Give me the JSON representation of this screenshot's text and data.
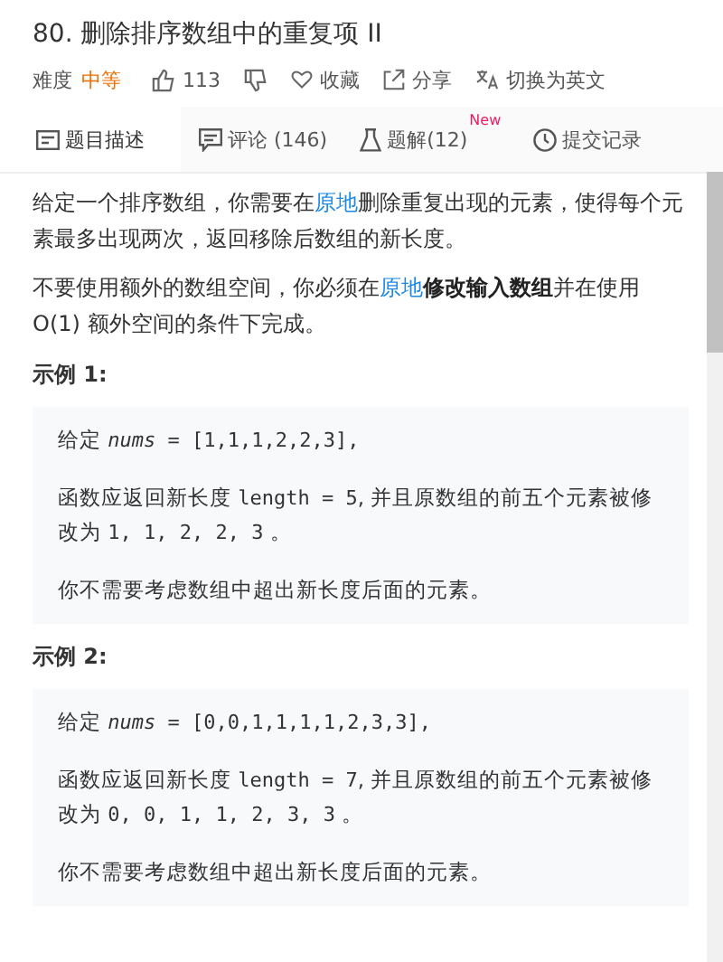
{
  "title": "80. 删除排序数组中的重复项 II",
  "meta": {
    "difficulty_label": "难度",
    "difficulty": "中等",
    "likes": "113",
    "actions": [
      {
        "kind": "heart",
        "label": "收藏"
      },
      {
        "kind": "share",
        "label": "分享"
      },
      {
        "kind": "translate",
        "label": "切换为英文"
      }
    ]
  },
  "tabs": [
    {
      "label": "题目描述",
      "selected": true
    },
    {
      "label": "评论 (146)",
      "selected": false
    },
    {
      "label": "题解(12)",
      "badge": "New",
      "selected": false
    },
    {
      "label": "提交记录",
      "selected": false
    }
  ],
  "paragraphs": [
    [
      {
        "kind": "plain",
        "text": "给定一个排序数组，你需要在"
      },
      {
        "kind": "link",
        "text": "原地"
      },
      {
        "kind": "plain",
        "text": "删除重复出现的元素，使得每个元素最多出现两次，返回移除后数组的新长度。"
      }
    ],
    [
      {
        "kind": "plain",
        "text": "不要使用额外的数组空间，你必须在"
      },
      {
        "kind": "link",
        "text": "原地"
      },
      {
        "kind": "bold",
        "text": "修改输入数组"
      },
      {
        "kind": "plain",
        "text": "并在使用 O(1) 额外空间的条件下完成。"
      }
    ]
  ],
  "examples": [
    {
      "heading": "示例 1:",
      "lines": [
        [
          {
            "kind": "plain",
            "text": "给定 "
          },
          {
            "kind": "var",
            "text": "nums"
          },
          {
            "kind": "code",
            "text": " = [1,1,1,2,2,3],"
          }
        ],
        [
          {
            "kind": "plain",
            "text": "函数应返回新长度 "
          },
          {
            "kind": "code",
            "text": "length = 5"
          },
          {
            "kind": "plain",
            "text": ", 并且原数组的前五个元素被修改为 "
          },
          {
            "kind": "code",
            "text": "1, 1, 2, 2, 3"
          },
          {
            "kind": "plain",
            "text": " 。"
          }
        ],
        [
          {
            "kind": "plain",
            "text": "你不需要考虑数组中超出新长度后面的元素。"
          }
        ]
      ]
    },
    {
      "heading": "示例 2:",
      "lines": [
        [
          {
            "kind": "plain",
            "text": "给定 "
          },
          {
            "kind": "var",
            "text": "nums"
          },
          {
            "kind": "code",
            "text": " = [0,0,1,1,1,1,2,3,3],"
          }
        ],
        [
          {
            "kind": "plain",
            "text": "函数应返回新长度 "
          },
          {
            "kind": "code",
            "text": "length = 7"
          },
          {
            "kind": "plain",
            "text": ", 并且原数组的前五个元素被修改为 "
          },
          {
            "kind": "code",
            "text": "0, 0, 1, 1, 2, 3, 3"
          },
          {
            "kind": "plain",
            "text": " 。"
          }
        ],
        [
          {
            "kind": "plain",
            "text": "你不需要考虑数组中超出新长度后面的元素。"
          }
        ]
      ]
    }
  ]
}
